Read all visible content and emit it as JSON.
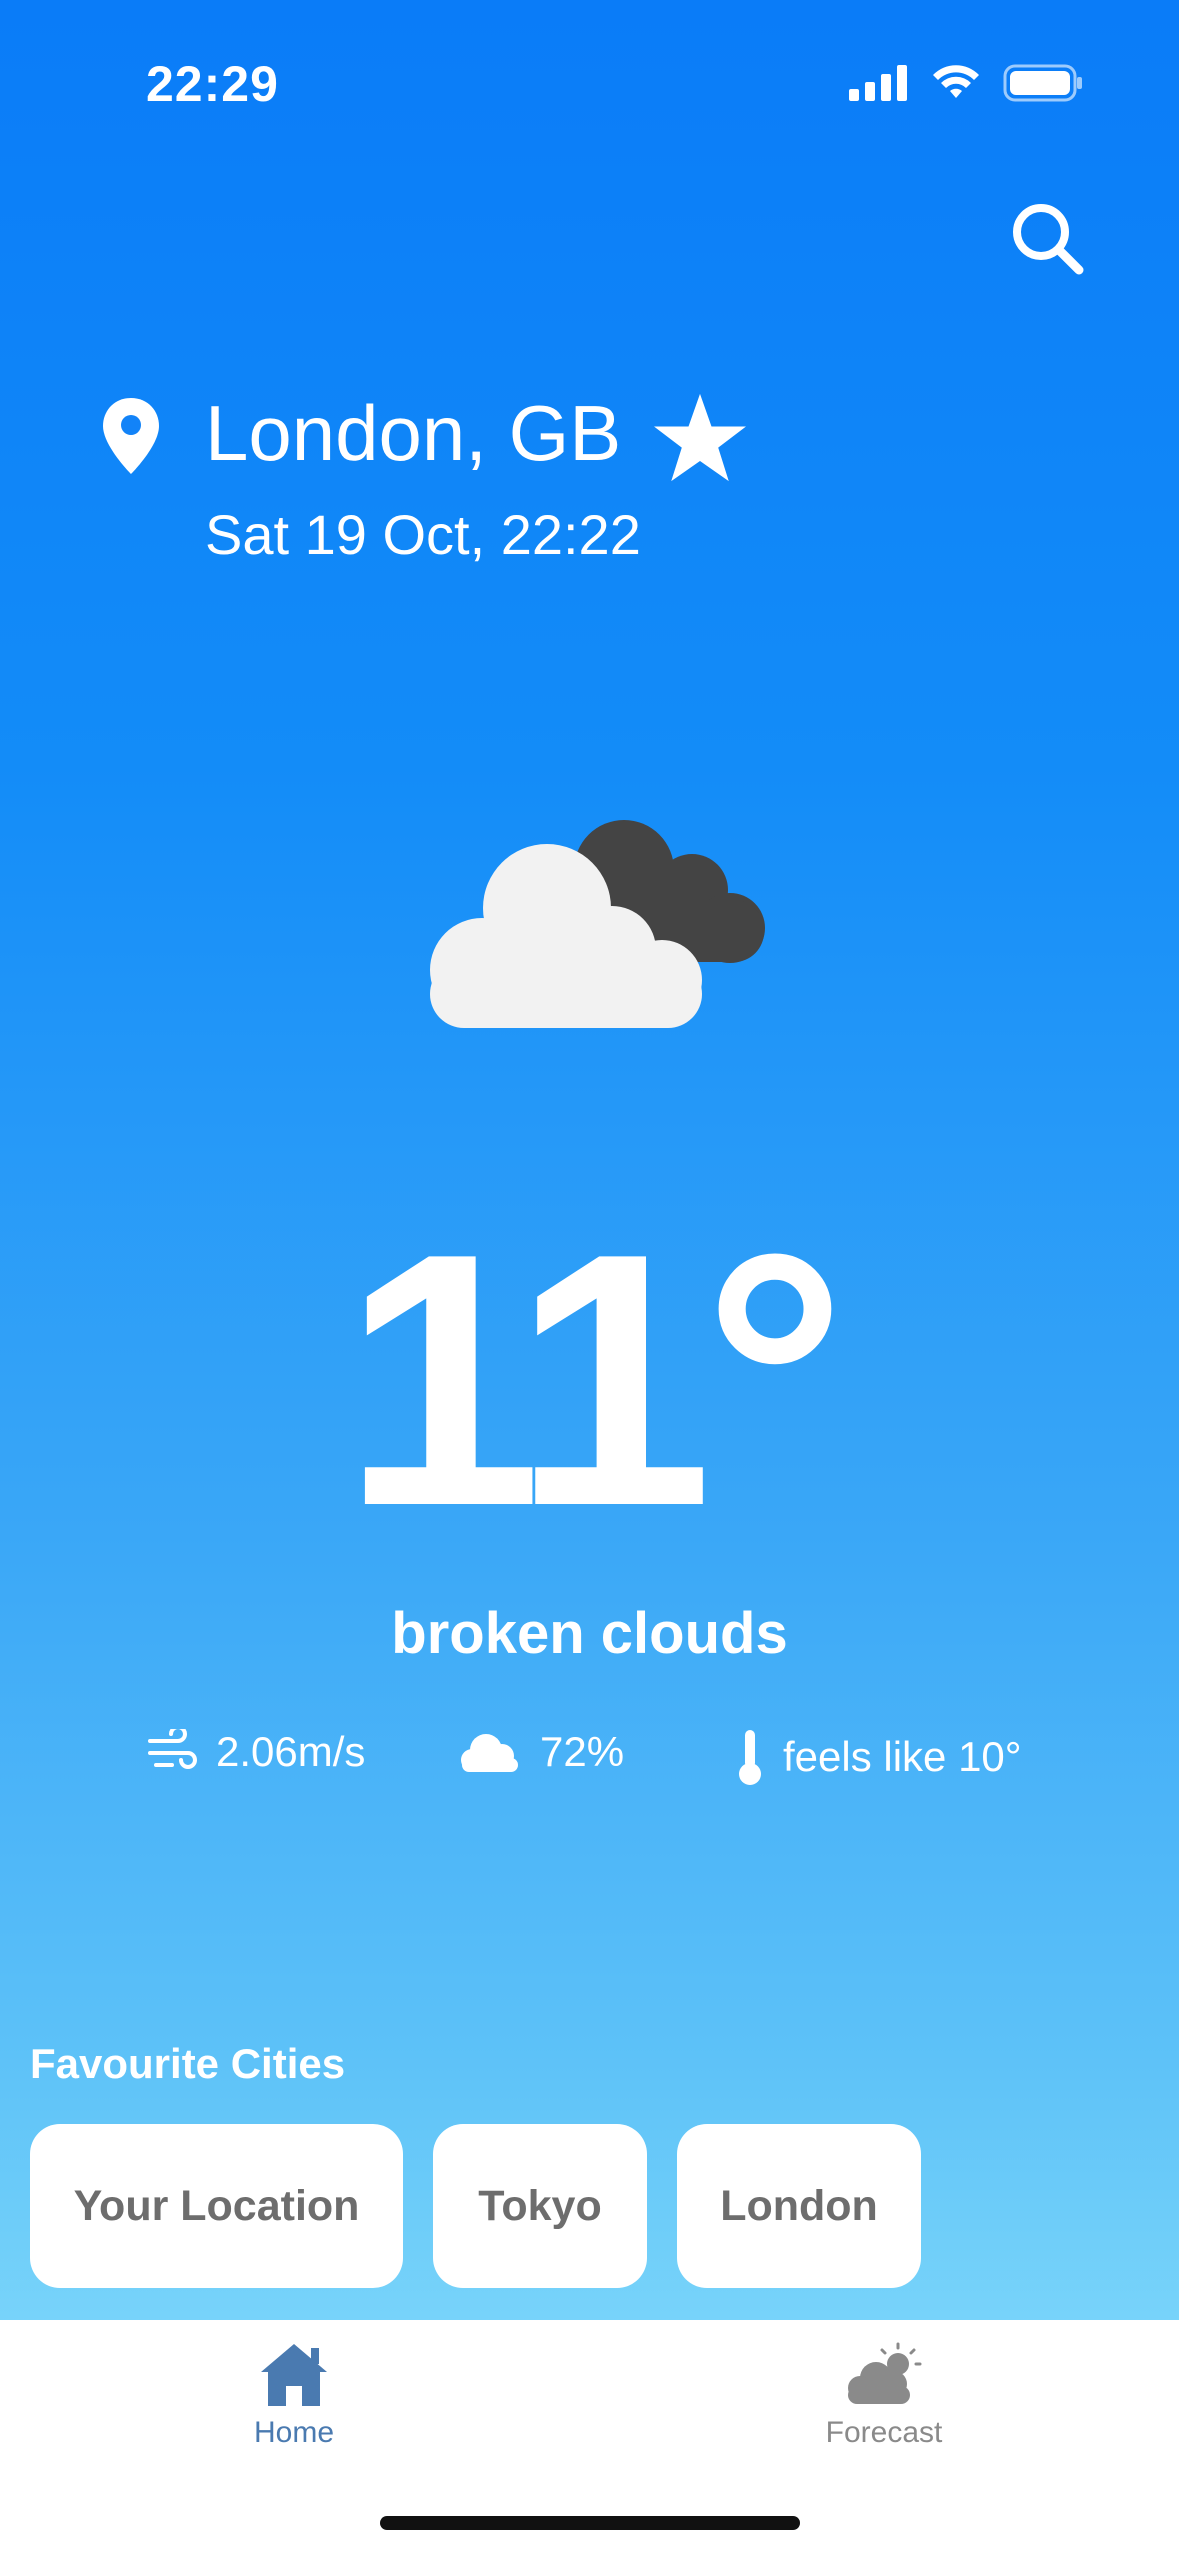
{
  "status_bar": {
    "time": "22:29"
  },
  "location": {
    "city": "London, GB",
    "datetime": "Sat 19 Oct, 22:22"
  },
  "current": {
    "temperature": "11°",
    "description": "broken clouds",
    "wind": "2.06m/s",
    "clouds": "72%",
    "feels_like": "feels like 10°"
  },
  "favourites": {
    "title": "Favourite Cities",
    "cities": [
      "Your Location",
      "Tokyo",
      "London"
    ]
  },
  "tabs": [
    {
      "label": "Home",
      "icon": "house-icon",
      "active": true
    },
    {
      "label": "Forecast",
      "icon": "cloud-sun-icon",
      "active": false
    }
  ],
  "colors": {
    "accent": "#4a7ab0",
    "inactive": "#8a8a8a",
    "sky_top": "#0a7cf8",
    "sky_bottom": "#8fe3fb"
  }
}
